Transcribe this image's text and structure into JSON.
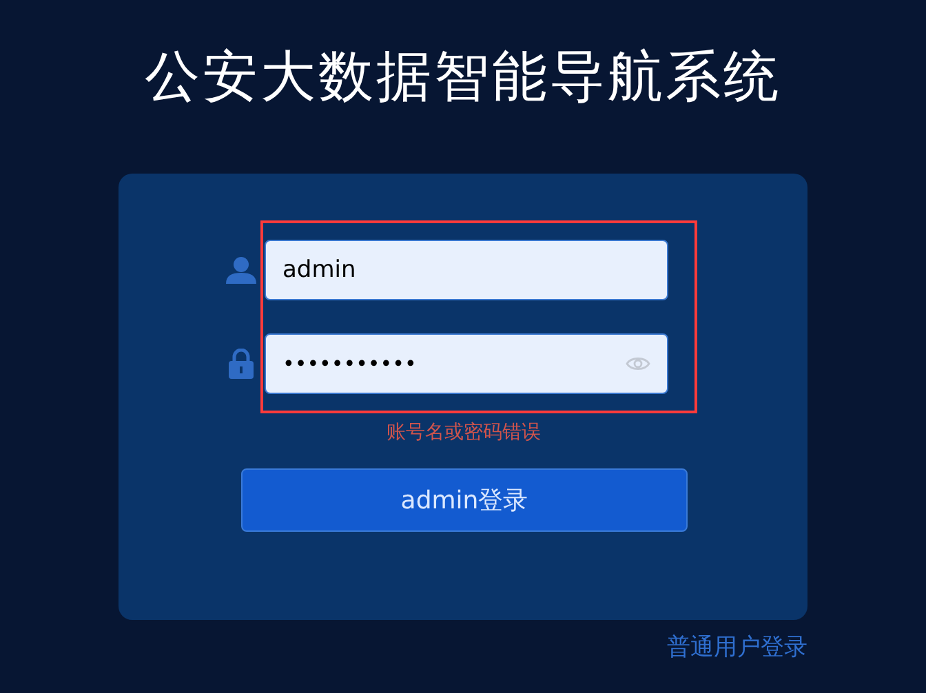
{
  "title": "公安大数据智能导航系统",
  "login_form": {
    "error_highlight": true,
    "username": {
      "value": "admin"
    },
    "password": {
      "value": "•••••••••••"
    },
    "error_message": "账号名或密码错误",
    "submit_button": "admin登录"
  },
  "alt_login_link": "普通用户登录"
}
